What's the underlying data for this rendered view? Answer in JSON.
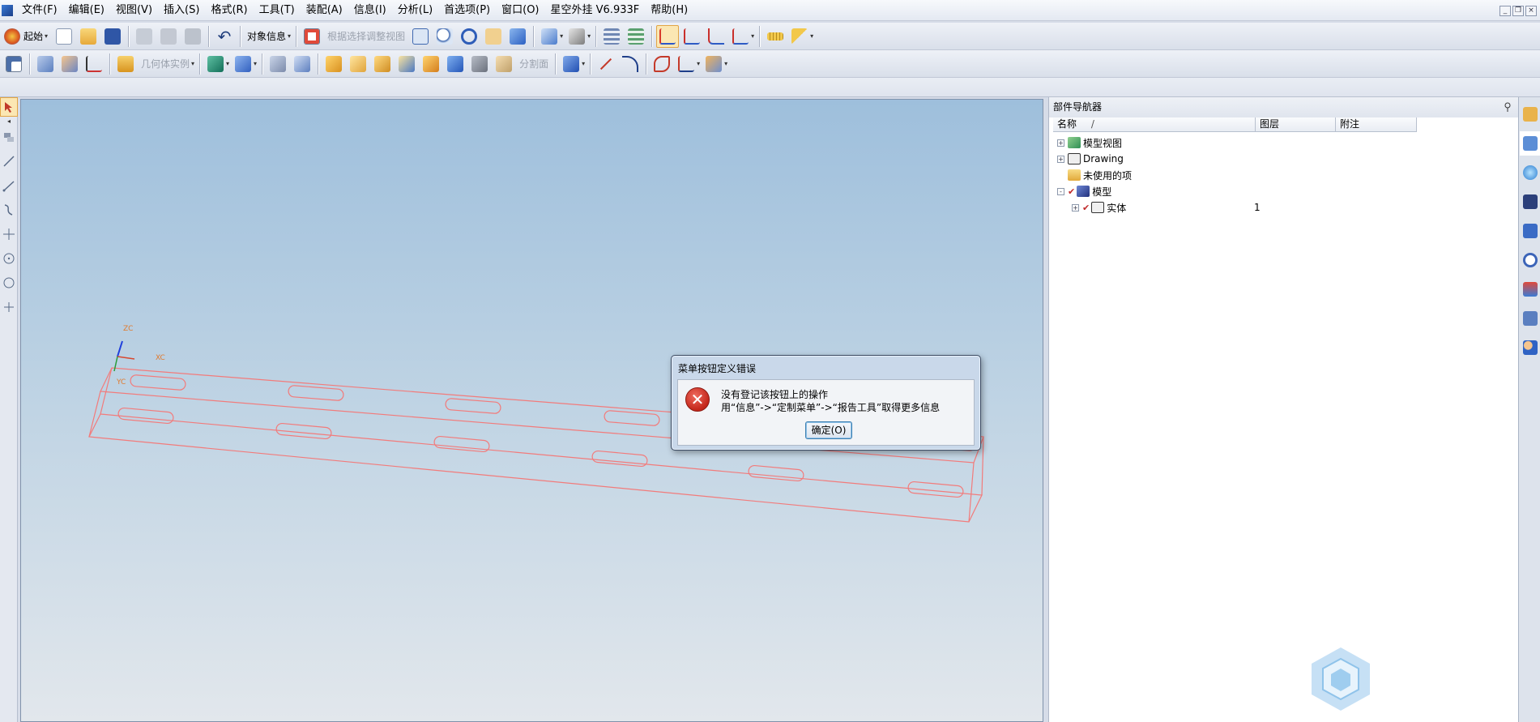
{
  "menubar": {
    "items": [
      "文件(F)",
      "编辑(E)",
      "视图(V)",
      "插入(S)",
      "格式(R)",
      "工具(T)",
      "装配(A)",
      "信息(I)",
      "分析(L)",
      "首选项(P)",
      "窗口(O)",
      "星空外挂 V6.933F",
      "帮助(H)"
    ]
  },
  "toolbar1": {
    "start_label": "起始",
    "object_info_label": "对象信息",
    "fit_view_label": "根据选择调整视图"
  },
  "toolbar2": {
    "geometry_instance_label": "几何体实例",
    "split_face_label": "分割面"
  },
  "viewport": {
    "axis_labels": {
      "zc": "ZC",
      "xc": "XC",
      "yc": "YC"
    },
    "model_color": "#f27b7b",
    "background_top": "#9ebfdc",
    "background_bottom": "#e2e7ec"
  },
  "dialog": {
    "title": "菜单按钮定义错误",
    "message_line1": "没有登记该按钮上的操作",
    "message_line2": "用“信息”->“定制菜单”->“报告工具”取得更多信息",
    "ok_label": "确定(O)",
    "icon": "error-icon"
  },
  "navigator": {
    "title": "部件导航器",
    "columns": {
      "name": "名称",
      "sort_mark": "/",
      "layer": "图层",
      "note": "附注"
    },
    "rows": [
      {
        "label": "模型视图",
        "expander": "+",
        "layer": ""
      },
      {
        "label": "Drawing",
        "expander": "+",
        "layer": ""
      },
      {
        "label": "未使用的项",
        "expander": "",
        "layer": ""
      },
      {
        "label": "模型",
        "expander": "-",
        "layer": ""
      },
      {
        "label": "实体",
        "expander": "+",
        "layer": "1"
      }
    ]
  }
}
